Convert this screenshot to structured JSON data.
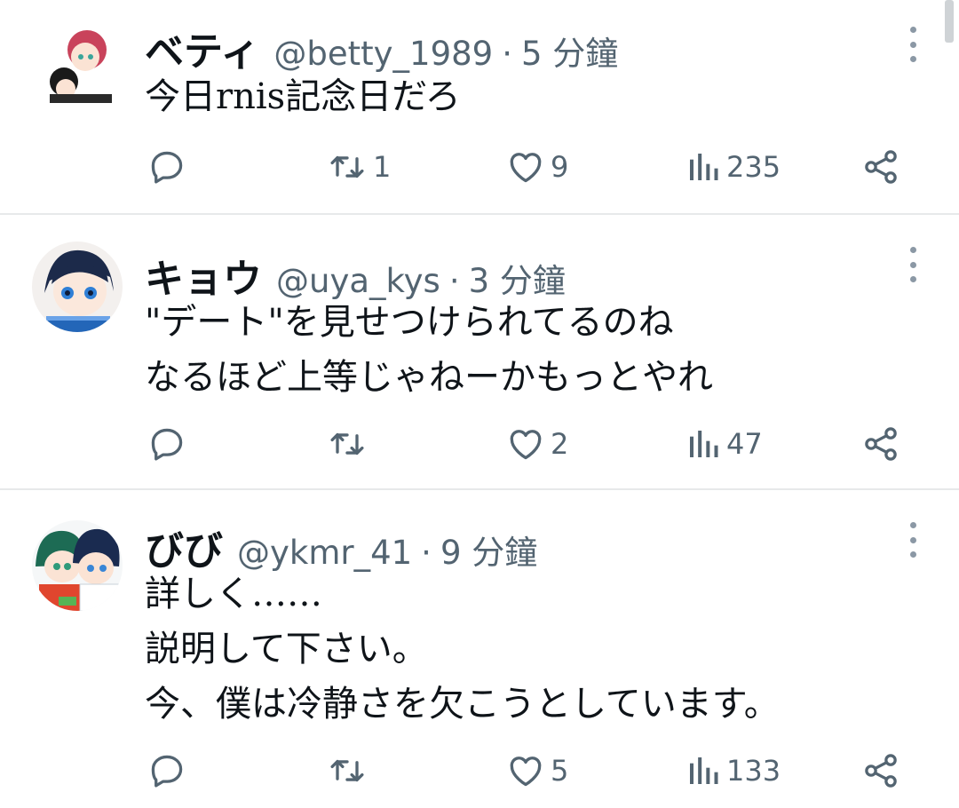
{
  "tweets": [
    {
      "name": "ベティ",
      "handle": "@betty_1989",
      "separator": "·",
      "time": "5 分鐘",
      "lines": [
        "今日rnis記念日だろ"
      ],
      "retweets": "1",
      "likes": "9",
      "views": "235"
    },
    {
      "name": "キョウ",
      "handle": "@uya_kys",
      "separator": "·",
      "time": "3 分鐘",
      "lines": [
        "\"デート\"を見せつけられてるのね",
        "なるほど上等じゃねーかもっとやれ"
      ],
      "retweets": "",
      "likes": "2",
      "views": "47"
    },
    {
      "name": "びび",
      "handle": "@ykmr_41",
      "separator": "·",
      "time": "9 分鐘",
      "lines": [
        "詳しく……",
        "説明して下さい。",
        "今、僕は冷静さを欠こうとしています。"
      ],
      "retweets": "",
      "likes": "5",
      "views": "133"
    }
  ],
  "icons": {
    "reply": "reply-icon",
    "retweet": "retweet-icon",
    "like": "heart-icon",
    "views": "views-icon",
    "share": "share-icon",
    "more": "more-icon"
  },
  "colors": {
    "text": "#0f1419",
    "secondary": "#536471",
    "divider": "#e7e9ea"
  }
}
